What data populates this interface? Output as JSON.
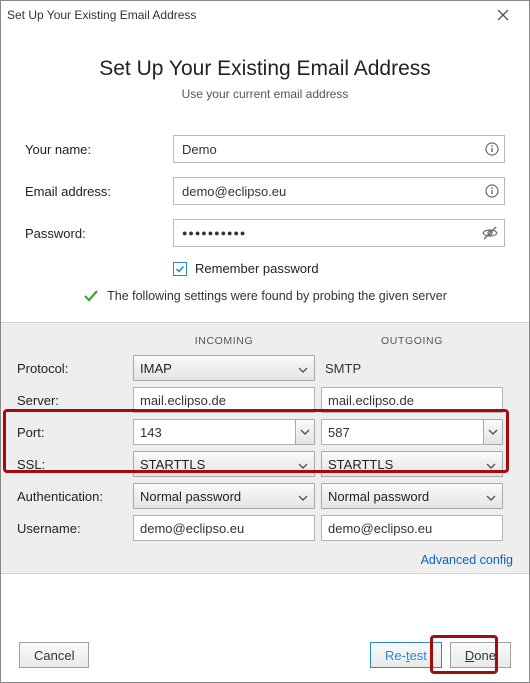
{
  "window_title": "Set Up Your Existing Email Address",
  "header": {
    "title": "Set Up Your Existing Email Address",
    "subtitle": "Use your current email address"
  },
  "labels": {
    "your_name": "Your name:",
    "email": "Email address:",
    "password": "Password:"
  },
  "values": {
    "your_name": "Demo",
    "email": "demo@eclipso.eu",
    "password_masked": "●●●●●●●●●●"
  },
  "remember": {
    "label": "Remember password",
    "checked": true
  },
  "status_msg": "The following settings were found by probing the given server",
  "grid": {
    "head_in": "INCOMING",
    "head_out": "OUTGOING",
    "labels": {
      "protocol": "Protocol:",
      "server": "Server:",
      "port": "Port:",
      "ssl": "SSL:",
      "auth": "Authentication:",
      "user": "Username:"
    },
    "incoming": {
      "protocol": "IMAP",
      "server": "mail.eclipso.de",
      "port": "143",
      "ssl": "STARTTLS",
      "auth": "Normal password",
      "user": "demo@eclipso.eu"
    },
    "outgoing": {
      "protocol": "SMTP",
      "server": "mail.eclipso.de",
      "port": "587",
      "ssl": "STARTTLS",
      "auth": "Normal password",
      "user": "demo@eclipso.eu"
    }
  },
  "advanced": "Advanced config",
  "buttons": {
    "cancel": "Cancel",
    "retest_pre": "Re-",
    "retest_accel": "t",
    "retest_post": "est",
    "done_accel": "D",
    "done_post": "one"
  }
}
